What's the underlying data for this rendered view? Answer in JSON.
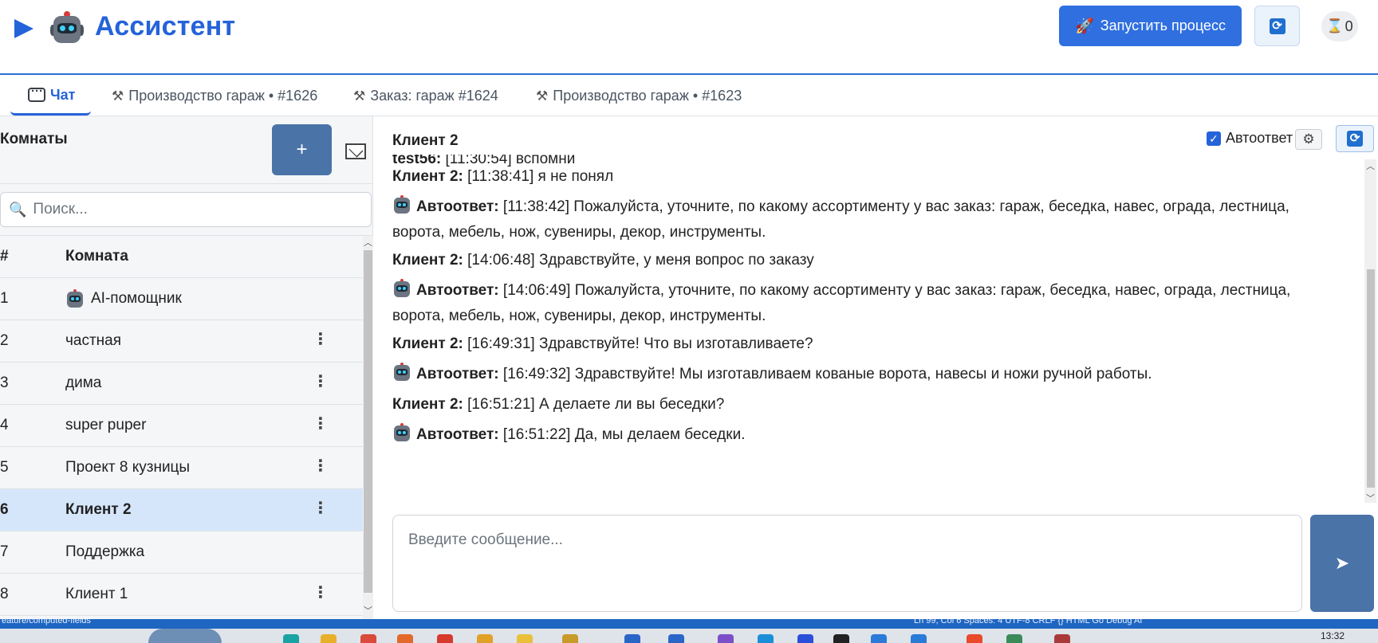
{
  "header": {
    "app_title": "Ассистент",
    "launch_label": "Запустить процесс",
    "timer_count": "0"
  },
  "tabs": [
    {
      "label": "Чат",
      "active": true
    },
    {
      "label": "Производство гараж • #1626"
    },
    {
      "label": "Заказ: гараж #1624"
    },
    {
      "label": "Производство гараж • #1623"
    }
  ],
  "sidebar": {
    "title": "Комнаты",
    "add_label": "+",
    "search_placeholder": "Поиск...",
    "columns": [
      "#",
      "Комната"
    ],
    "rooms": [
      {
        "num": "1",
        "name": "AI-помощник",
        "robot": true,
        "menu": false
      },
      {
        "num": "2",
        "name": "частная",
        "menu": true
      },
      {
        "num": "3",
        "name": "дима",
        "menu": true
      },
      {
        "num": "4",
        "name": "super puper",
        "menu": true
      },
      {
        "num": "5",
        "name": "Проект 8 кузницы",
        "menu": true
      },
      {
        "num": "6",
        "name": "Клиент 2",
        "menu": true,
        "selected": true
      },
      {
        "num": "7",
        "name": "Поддержка",
        "menu": false
      },
      {
        "num": "8",
        "name": "Клиент 1",
        "menu": true
      }
    ]
  },
  "chat": {
    "title": "Клиент 2",
    "autoreply_label": "Автоответ",
    "autoreply_checked": true,
    "input_placeholder": "Введите сообщение...",
    "send_label": "➤",
    "messages": [
      {
        "author": "test56:",
        "text": "[11:30:54] вспомни",
        "robot": false,
        "partial": true
      },
      {
        "author": "Клиент 2:",
        "text": "[11:38:41] я не понял",
        "robot": false
      },
      {
        "author": "Автоответ:",
        "text": "[11:38:42] Пожалуйста, уточните, по какому ассортименту у вас заказ: гараж, беседка, навес, ограда, лестница,",
        "text2": "ворота, мебель, нож, сувениры, декор, инструменты.",
        "robot": true
      },
      {
        "author": "Клиент 2:",
        "text": "[14:06:48] Здравствуйте, у меня вопрос по заказу",
        "robot": false
      },
      {
        "author": "Автоответ:",
        "text": "[14:06:49] Пожалуйста, уточните, по какому ассортименту у вас заказ: гараж, беседка, навес, ограда, лестница,",
        "text2": "ворота, мебель, нож, сувениры, декор, инструменты.",
        "robot": true
      },
      {
        "author": "Клиент 2:",
        "text": "[16:49:31] Здравствуйте! Что вы изготавливаете?",
        "robot": false
      },
      {
        "author": "Автоответ:",
        "text": "[16:49:32] Здравствуйте! Мы изготавливаем кованые ворота, навесы и ножи ручной работы.",
        "robot": true
      },
      {
        "author": "Клиент 2:",
        "text": "[16:51:21] А делаете ли вы беседки?",
        "robot": false
      },
      {
        "author": "Автоответ:",
        "text": "[16:51:22] Да, мы делаем беседки.",
        "robot": true
      }
    ]
  },
  "statusbar": {
    "left_text": "eature/computed-fields",
    "right_text": "Ln 99, Col 6    Spaces: 4    UTF-8    CRLF    {} HTML    Go Debug AI"
  },
  "taskbar": {
    "clock": "13:32"
  },
  "colors": {
    "accent": "#2563d9",
    "button_blue": "#2f6fe0",
    "button_steel": "#4a73a8",
    "selected_row": "#d6e6fa"
  }
}
